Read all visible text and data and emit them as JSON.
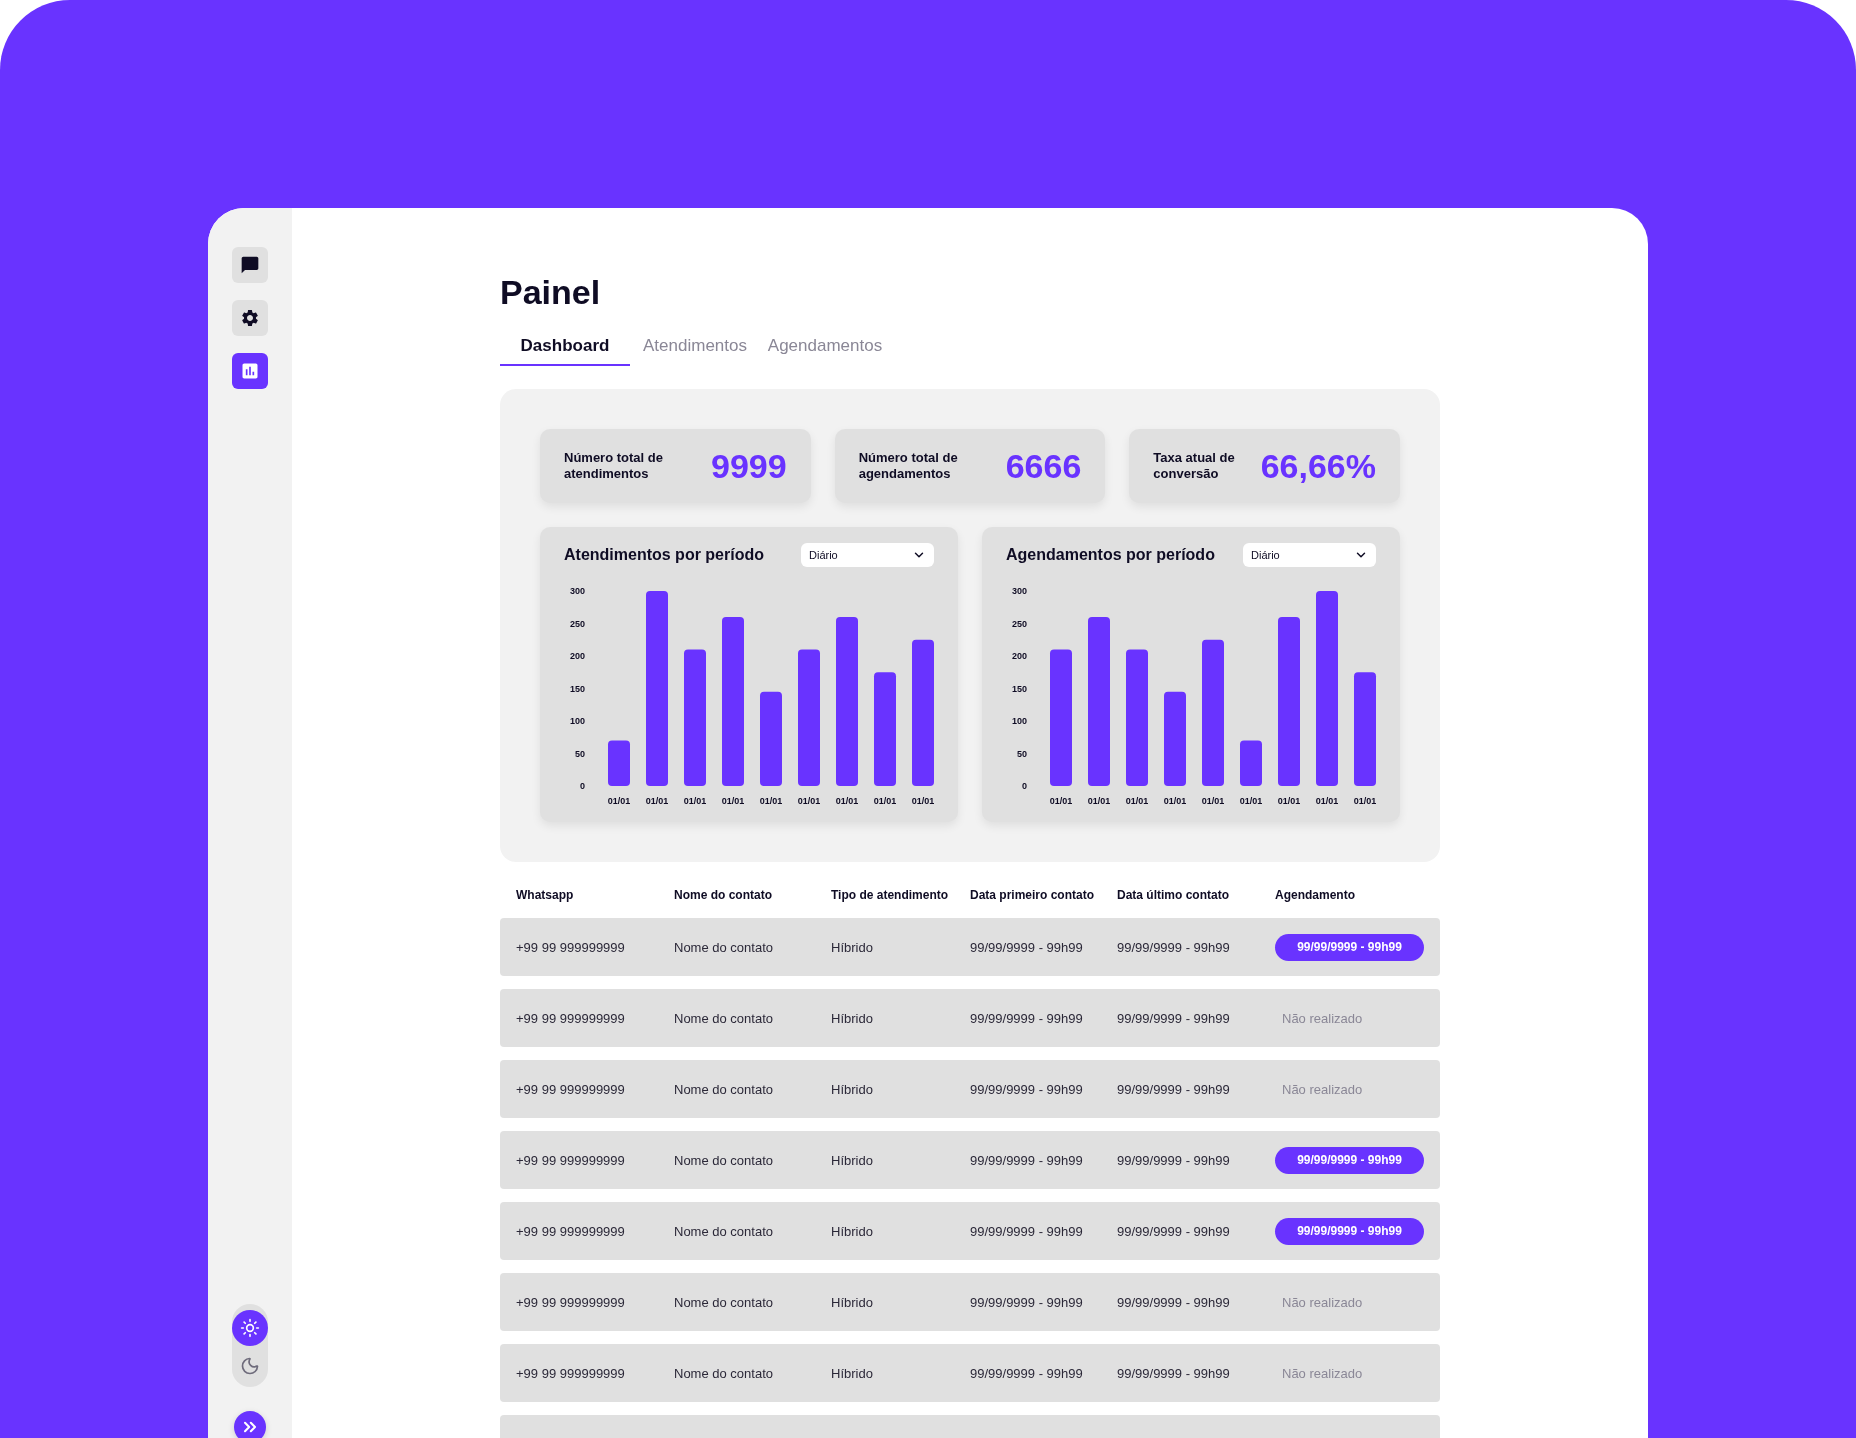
{
  "sidebar": {
    "items": [
      {
        "selected": false
      },
      {
        "selected": false
      },
      {
        "selected": true
      }
    ],
    "theme_options": [
      {
        "selected": true
      },
      {
        "selected": false
      }
    ]
  },
  "page": {
    "title": "Painel"
  },
  "tabs": [
    {
      "label": "Dashboard",
      "selected": true
    },
    {
      "label": "Atendimentos",
      "selected": false
    },
    {
      "label": "Agendamentos",
      "selected": false
    }
  ],
  "stats": [
    {
      "label": "Número total de atendimentos",
      "value": "9999"
    },
    {
      "label": "Número total de agendamentos",
      "value": "6666"
    },
    {
      "label": "Taxa atual de conversão",
      "value": "66,66%"
    }
  ],
  "charts": [
    {
      "period_select": {
        "value": "Diário"
      },
      "chart_data": {
        "type": "bar",
        "title": "Atendimentos por período",
        "categories": [
          "01/01",
          "01/01",
          "01/01",
          "01/01",
          "01/01",
          "01/01",
          "01/01",
          "01/01",
          "01/01"
        ],
        "values": [
          70,
          300,
          210,
          260,
          145,
          210,
          260,
          175,
          225
        ],
        "ylim": [
          0,
          300
        ],
        "yticks": [
          0,
          50,
          100,
          150,
          200,
          250,
          300
        ]
      }
    },
    {
      "period_select": {
        "value": "Diário"
      },
      "chart_data": {
        "type": "bar",
        "title": "Agendamentos por período",
        "categories": [
          "01/01",
          "01/01",
          "01/01",
          "01/01",
          "01/01",
          "01/01",
          "01/01",
          "01/01",
          "01/01"
        ],
        "values": [
          210,
          260,
          210,
          145,
          225,
          70,
          260,
          300,
          175
        ],
        "ylim": [
          0,
          300
        ],
        "yticks": [
          0,
          50,
          100,
          150,
          200,
          250,
          300
        ]
      }
    }
  ],
  "table": {
    "columns": [
      "Whatsapp",
      "Nome do contato",
      "Tipo de atendimento",
      "Data primeiro contato",
      "Data último contato",
      "Agendamento"
    ],
    "rows": [
      {
        "whatsapp": "+99 99 999999999",
        "contact_name": "Nome do contato",
        "service_type": "Híbrido",
        "first_contact": "99/99/9999 - 99h99",
        "last_contact": "99/99/9999 - 99h99",
        "appointment": {
          "kind": "scheduled",
          "text": "99/99/9999 - 99h99"
        }
      },
      {
        "whatsapp": "+99 99 999999999",
        "contact_name": "Nome do contato",
        "service_type": "Híbrido",
        "first_contact": "99/99/9999 - 99h99",
        "last_contact": "99/99/9999 - 99h99",
        "appointment": {
          "kind": "not_done",
          "text": "Não realizado"
        }
      },
      {
        "whatsapp": "+99 99 999999999",
        "contact_name": "Nome do contato",
        "service_type": "Híbrido",
        "first_contact": "99/99/9999 - 99h99",
        "last_contact": "99/99/9999 - 99h99",
        "appointment": {
          "kind": "not_done",
          "text": "Não realizado"
        }
      },
      {
        "whatsapp": "+99 99 999999999",
        "contact_name": "Nome do contato",
        "service_type": "Híbrido",
        "first_contact": "99/99/9999 - 99h99",
        "last_contact": "99/99/9999 - 99h99",
        "appointment": {
          "kind": "scheduled",
          "text": "99/99/9999 - 99h99"
        }
      },
      {
        "whatsapp": "+99 99 999999999",
        "contact_name": "Nome do contato",
        "service_type": "Híbrido",
        "first_contact": "99/99/9999 - 99h99",
        "last_contact": "99/99/9999 - 99h99",
        "appointment": {
          "kind": "scheduled",
          "text": "99/99/9999 - 99h99"
        }
      },
      {
        "whatsapp": "+99 99 999999999",
        "contact_name": "Nome do contato",
        "service_type": "Híbrido",
        "first_contact": "99/99/9999 - 99h99",
        "last_contact": "99/99/9999 - 99h99",
        "appointment": {
          "kind": "not_done",
          "text": "Não realizado"
        }
      },
      {
        "whatsapp": "+99 99 999999999",
        "contact_name": "Nome do contato",
        "service_type": "Híbrido",
        "first_contact": "99/99/9999 - 99h99",
        "last_contact": "99/99/9999 - 99h99",
        "appointment": {
          "kind": "not_done",
          "text": "Não realizado"
        }
      }
    ]
  }
}
